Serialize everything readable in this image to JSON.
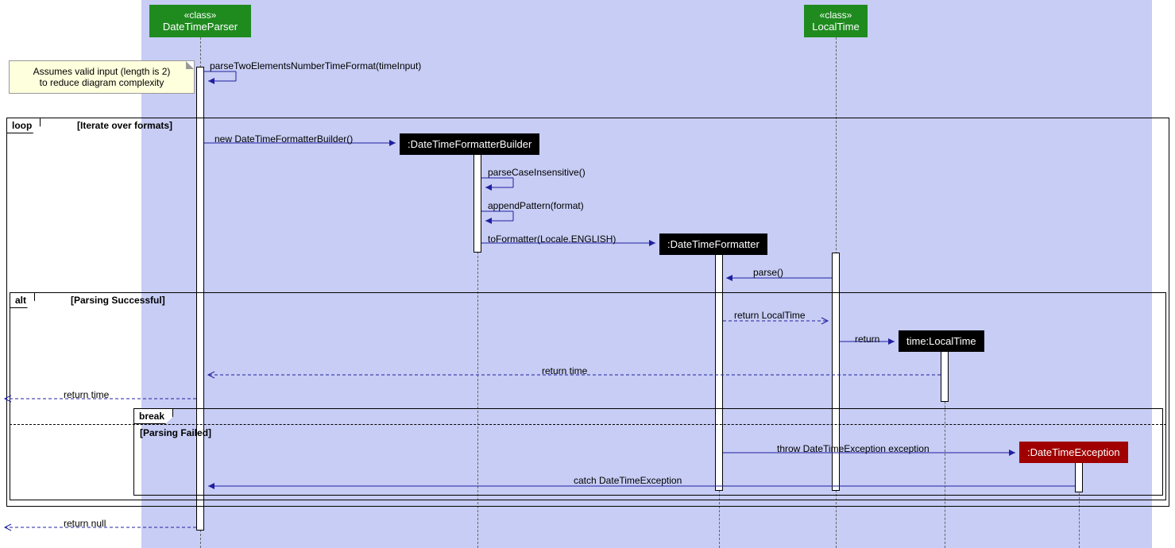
{
  "participants": {
    "dtp": {
      "stereo": "«class»",
      "name": "DateTimeParser"
    },
    "lt_class": {
      "stereo": "«class»",
      "name": "LocalTime"
    },
    "builder": ":DateTimeFormatterBuilder",
    "formatter": ":DateTimeFormatter",
    "time_inst": "time:LocalTime",
    "exc": ":DateTimeException"
  },
  "note": {
    "line1": "Assumes valid input (length is 2)",
    "line2": "to reduce diagram complexity"
  },
  "frames": {
    "loop": {
      "tab": "loop",
      "cond": "[Iterate over formats]"
    },
    "alt": {
      "tab": "alt",
      "cond": "[Parsing Successful]"
    },
    "break": {
      "tab": "break"
    },
    "alt_else": "[Parsing Failed]"
  },
  "messages": {
    "m1": "parseTwoElementsNumberTimeFormat(timeInput)",
    "m2": "new DateTimeFormatterBuilder()",
    "m3": "parseCaseInsensitive()",
    "m4": "appendPattern(format)",
    "m5": "toFormatter(Locale.ENGLISH)",
    "m6": "parse()",
    "m7": "return LocalTime",
    "m8": "return",
    "m9": "return time",
    "m10": "return time",
    "m11": "throw DateTimeException exception",
    "m12": "catch DateTimeException",
    "m13": "return null"
  }
}
